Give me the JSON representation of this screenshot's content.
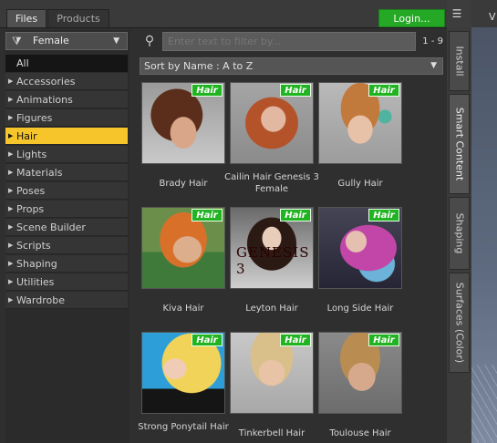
{
  "tabs": {
    "files": "Files",
    "products": "Products"
  },
  "login_label": "Login...",
  "gender_filter": "Female",
  "categories_all": "All",
  "categories": [
    {
      "label": "Accessories",
      "selected": false
    },
    {
      "label": "Animations",
      "selected": false
    },
    {
      "label": "Figures",
      "selected": false
    },
    {
      "label": "Hair",
      "selected": true
    },
    {
      "label": "Lights",
      "selected": false
    },
    {
      "label": "Materials",
      "selected": false
    },
    {
      "label": "Poses",
      "selected": false
    },
    {
      "label": "Props",
      "selected": false
    },
    {
      "label": "Scene Builder",
      "selected": false
    },
    {
      "label": "Scripts",
      "selected": false
    },
    {
      "label": "Shaping",
      "selected": false
    },
    {
      "label": "Utilities",
      "selected": false
    },
    {
      "label": "Wardrobe",
      "selected": false
    }
  ],
  "filter": {
    "placeholder": "Enter text to filter by...",
    "range": "1 - 9"
  },
  "sort_label": "Sort by Name : A to Z",
  "items": [
    {
      "name": "Brady Hair",
      "badge": "Hair"
    },
    {
      "name": "Cailin Hair Genesis 3 Female",
      "badge": "Hair"
    },
    {
      "name": "Gully Hair",
      "badge": "Hair"
    },
    {
      "name": "Kiva Hair",
      "badge": "Hair"
    },
    {
      "name": "Leyton Hair",
      "badge": "Hair",
      "watermark": "GENESIS 3"
    },
    {
      "name": "Long Side Hair",
      "badge": "Hair"
    },
    {
      "name": "Strong Ponytail Hair",
      "badge": "Hair"
    },
    {
      "name": "Tinkerbell Hair",
      "badge": "Hair"
    },
    {
      "name": "Toulouse Hair",
      "badge": "Hair"
    }
  ],
  "side_tabs": [
    "Install",
    "Smart Content",
    "Shaping",
    "Surfaces (Color)"
  ],
  "viewport_label": "V",
  "colors": {
    "accent": "#f5c52b",
    "login": "#25a825",
    "badge": "#22b322"
  }
}
